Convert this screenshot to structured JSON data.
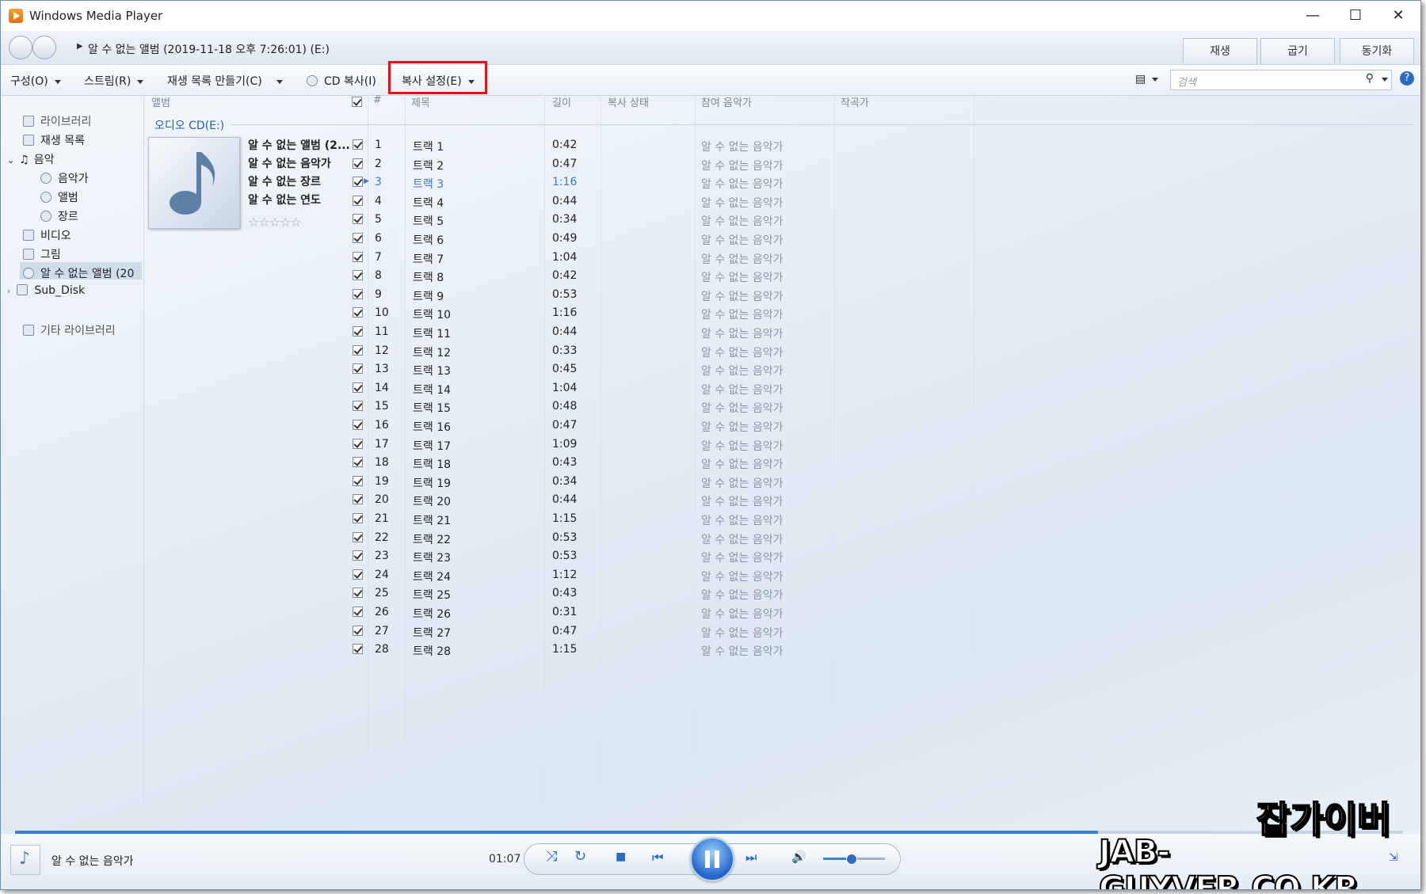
{
  "window": {
    "title": "Windows Media Player",
    "minimize": "—",
    "maximize": "☐",
    "close": "✕"
  },
  "nav": {
    "breadcrumb": "알 수 없는 앨범 (2019-11-18 오후 7:26:01) (E:)",
    "tabs": [
      "재생",
      "굽기",
      "동기화"
    ]
  },
  "toolbar": {
    "organize": "구성(O)",
    "stream": "스트림(R)",
    "create_playlist": "재생 목록 만들기(C)",
    "rip_cd": "CD 복사(I)",
    "rip_settings": "복사 설정(E)",
    "search_placeholder": "검색"
  },
  "sidebar": {
    "library": "라이브러리",
    "playlists": "재생 목록",
    "music": "음악",
    "artist": "음악가",
    "album": "앨범",
    "genre": "장르",
    "video": "비디오",
    "pictures": "그림",
    "cd": "알 수 없는 앨범 (20",
    "sub_disk": "Sub_Disk",
    "other_libraries": "기타 라이브러리"
  },
  "columns": {
    "album": "앨범",
    "num": "#",
    "title": "제목",
    "length": "길이",
    "rip_status": "복사 상태",
    "contributing_artist": "참여 음악가",
    "composer": "작곡가"
  },
  "group_label": "오디오 CD(E:)",
  "album_info": {
    "album": "알 수 없는 앨범 (2...",
    "artist": "알 수 없는 음악가",
    "genre": "알 수 없는 장르",
    "year": "알 수 없는 연도",
    "rating": "☆☆☆☆☆"
  },
  "tracks": [
    {
      "n": "1",
      "title": "트랙 1",
      "len": "0:42",
      "artist": "알 수 없는 음악가"
    },
    {
      "n": "2",
      "title": "트랙 2",
      "len": "0:47",
      "artist": "알 수 없는 음악가"
    },
    {
      "n": "3",
      "title": "트랙 3",
      "len": "1:16",
      "artist": "알 수 없는 음악가"
    },
    {
      "n": "4",
      "title": "트랙 4",
      "len": "0:44",
      "artist": "알 수 없는 음악가"
    },
    {
      "n": "5",
      "title": "트랙 5",
      "len": "0:34",
      "artist": "알 수 없는 음악가"
    },
    {
      "n": "6",
      "title": "트랙 6",
      "len": "0:49",
      "artist": "알 수 없는 음악가"
    },
    {
      "n": "7",
      "title": "트랙 7",
      "len": "1:04",
      "artist": "알 수 없는 음악가"
    },
    {
      "n": "8",
      "title": "트랙 8",
      "len": "0:42",
      "artist": "알 수 없는 음악가"
    },
    {
      "n": "9",
      "title": "트랙 9",
      "len": "0:53",
      "artist": "알 수 없는 음악가"
    },
    {
      "n": "10",
      "title": "트랙 10",
      "len": "1:16",
      "artist": "알 수 없는 음악가"
    },
    {
      "n": "11",
      "title": "트랙 11",
      "len": "0:44",
      "artist": "알 수 없는 음악가"
    },
    {
      "n": "12",
      "title": "트랙 12",
      "len": "0:33",
      "artist": "알 수 없는 음악가"
    },
    {
      "n": "13",
      "title": "트랙 13",
      "len": "0:45",
      "artist": "알 수 없는 음악가"
    },
    {
      "n": "14",
      "title": "트랙 14",
      "len": "1:04",
      "artist": "알 수 없는 음악가"
    },
    {
      "n": "15",
      "title": "트랙 15",
      "len": "0:48",
      "artist": "알 수 없는 음악가"
    },
    {
      "n": "16",
      "title": "트랙 16",
      "len": "0:47",
      "artist": "알 수 없는 음악가"
    },
    {
      "n": "17",
      "title": "트랙 17",
      "len": "1:09",
      "artist": "알 수 없는 음악가"
    },
    {
      "n": "18",
      "title": "트랙 18",
      "len": "0:43",
      "artist": "알 수 없는 음악가"
    },
    {
      "n": "19",
      "title": "트랙 19",
      "len": "0:34",
      "artist": "알 수 없는 음악가"
    },
    {
      "n": "20",
      "title": "트랙 20",
      "len": "0:44",
      "artist": "알 수 없는 음악가"
    },
    {
      "n": "21",
      "title": "트랙 21",
      "len": "1:15",
      "artist": "알 수 없는 음악가"
    },
    {
      "n": "22",
      "title": "트랙 22",
      "len": "0:53",
      "artist": "알 수 없는 음악가"
    },
    {
      "n": "23",
      "title": "트랙 23",
      "len": "0:53",
      "artist": "알 수 없는 음악가"
    },
    {
      "n": "24",
      "title": "트랙 24",
      "len": "1:12",
      "artist": "알 수 없는 음악가"
    },
    {
      "n": "25",
      "title": "트랙 25",
      "len": "0:43",
      "artist": "알 수 없는 음악가"
    },
    {
      "n": "26",
      "title": "트랙 26",
      "len": "0:31",
      "artist": "알 수 없는 음악가"
    },
    {
      "n": "27",
      "title": "트랙 27",
      "len": "0:47",
      "artist": "알 수 없는 음악가"
    },
    {
      "n": "28",
      "title": "트랙 28",
      "len": "1:15",
      "artist": "알 수 없는 음악가"
    }
  ],
  "active_track_index": 2,
  "player": {
    "now_playing": "알 수 없는 음악가",
    "elapsed": "01:07",
    "seek_fraction": 0.78,
    "volume_fraction": 0.45
  },
  "watermark": {
    "line1": "잡가이버",
    "line2": "JAB-GUYVER.CO.KR"
  },
  "colors": {
    "highlight_box": "#e0141b",
    "accent": "#3d7fd0"
  }
}
